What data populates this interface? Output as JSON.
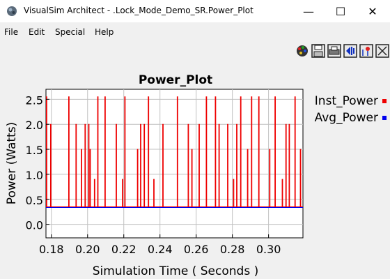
{
  "window": {
    "title": "VisualSim Architect - .Lock_Mode_Demo_SR.Power_Plot",
    "controls": {
      "minimize": "—",
      "maximize": "☐",
      "close": "✕"
    }
  },
  "menu": [
    "File",
    "Edit",
    "Special",
    "Help"
  ],
  "toolbar": {
    "icons": [
      "palette-icon",
      "save-icon",
      "print-icon",
      "fill-icon",
      "points-icon",
      "reset-icon"
    ]
  },
  "colors": {
    "inst": "#ee0000",
    "avg": "#0000ee",
    "grid": "#c0c0c0",
    "plot_bg": "#ffffff"
  },
  "chart_data": {
    "type": "line",
    "title": "Power_Plot",
    "xlabel": "Simulation Time ( Seconds )",
    "ylabel": "Power (Watts)",
    "xlim": [
      0.177,
      0.319
    ],
    "ylim": [
      -0.27,
      2.7
    ],
    "xticks": [
      0.18,
      0.2,
      0.22,
      0.24,
      0.26,
      0.28,
      0.3
    ],
    "xtick_labels": [
      "0.18",
      "0.20",
      "0.22",
      "0.24",
      "0.26",
      "0.28",
      "0.30"
    ],
    "yticks": [
      0.0,
      0.5,
      1.0,
      1.5,
      2.0,
      2.5
    ],
    "ytick_labels": [
      "0.0",
      "0.5",
      "1.0",
      "1.5",
      "2.0",
      "2.5"
    ],
    "grid": true,
    "legend_position": "right",
    "series": [
      {
        "name": "Inst_Power",
        "baseline": 0.35,
        "spikes": [
          [
            0.1772,
            2.55
          ],
          [
            0.1795,
            2.0
          ],
          [
            0.1895,
            2.55
          ],
          [
            0.1935,
            2.0
          ],
          [
            0.1965,
            1.5
          ],
          [
            0.1985,
            2.0
          ],
          [
            0.2005,
            2.0
          ],
          [
            0.2013,
            1.5
          ],
          [
            0.2037,
            0.9
          ],
          [
            0.2055,
            2.55
          ],
          [
            0.2095,
            2.55
          ],
          [
            0.2157,
            2.0
          ],
          [
            0.2192,
            0.9
          ],
          [
            0.2205,
            2.55
          ],
          [
            0.2275,
            1.5
          ],
          [
            0.2292,
            2.0
          ],
          [
            0.2312,
            2.0
          ],
          [
            0.2335,
            2.55
          ],
          [
            0.2365,
            0.9
          ],
          [
            0.2415,
            2.0
          ],
          [
            0.2495,
            2.55
          ],
          [
            0.2555,
            2.0
          ],
          [
            0.2575,
            1.5
          ],
          [
            0.2615,
            2.0
          ],
          [
            0.2655,
            2.55
          ],
          [
            0.2705,
            2.55
          ],
          [
            0.2725,
            2.0
          ],
          [
            0.2773,
            2.0
          ],
          [
            0.2805,
            0.9
          ],
          [
            0.2823,
            2.0
          ],
          [
            0.2845,
            2.55
          ],
          [
            0.2883,
            1.5
          ],
          [
            0.2905,
            2.55
          ],
          [
            0.2945,
            2.55
          ],
          [
            0.3005,
            1.5
          ],
          [
            0.3035,
            2.55
          ],
          [
            0.3075,
            0.9
          ],
          [
            0.3095,
            2.0
          ],
          [
            0.3113,
            2.0
          ],
          [
            0.3145,
            2.55
          ],
          [
            0.3175,
            1.5
          ]
        ]
      },
      {
        "name": "Avg_Power",
        "baseline": 0.34
      }
    ]
  }
}
